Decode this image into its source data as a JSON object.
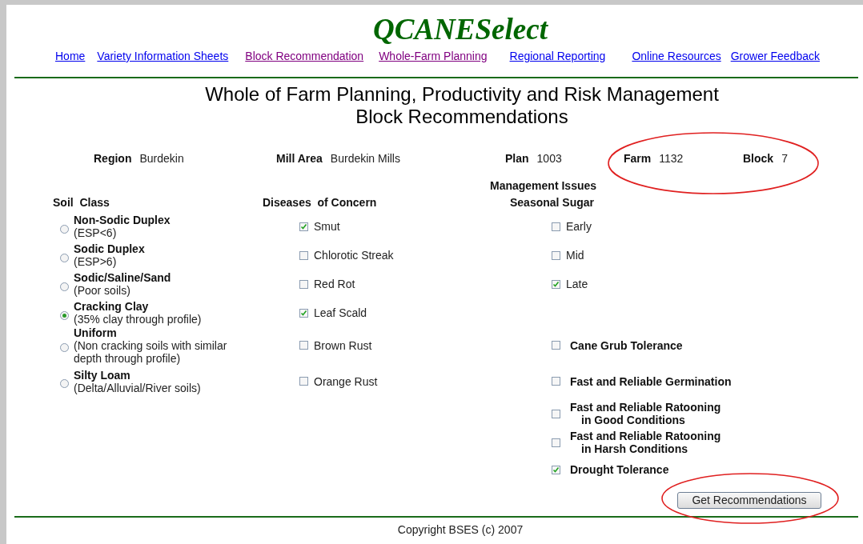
{
  "site_title": "QCANESelect",
  "nav": [
    {
      "label": "Home",
      "visited": false
    },
    {
      "label": "Variety Information Sheets",
      "visited": false
    },
    {
      "label": "Block Recommendation",
      "visited": true
    },
    {
      "label": "Whole-Farm Planning",
      "visited": true
    },
    {
      "label": "Regional Reporting",
      "visited": false
    },
    {
      "label": "Online Resources",
      "visited": false
    },
    {
      "label": "Grower Feedback",
      "visited": false
    }
  ],
  "heading": [
    "Whole of Farm Planning, Productivity and Risk Management",
    "Block Recommendations"
  ],
  "info": [
    {
      "label": "Region",
      "value": "Burdekin"
    },
    {
      "label": "Mill Area",
      "value": "Burdekin Mills"
    },
    {
      "label": "Plan",
      "value": "1003"
    },
    {
      "label": "Farm",
      "value": "1132"
    },
    {
      "label": "Block",
      "value": "7"
    }
  ],
  "soil_class": {
    "title": "Soil  Class",
    "options": [
      {
        "name": "Non-Sodic Duplex",
        "description": "(ESP<6)",
        "selected": false
      },
      {
        "name": "Sodic Duplex",
        "description": "(ESP>6)",
        "selected": false
      },
      {
        "name": "Sodic/Saline/Sand",
        "description": "(Poor soils)",
        "selected": false
      },
      {
        "name": "Cracking Clay",
        "description": "(35% clay through profile)",
        "selected": true
      },
      {
        "name": "Uniform",
        "description": "(Non cracking soils with similar depth through profile)",
        "selected": false
      },
      {
        "name": "Silty Loam",
        "description": "(Delta/Alluvial/River soils)",
        "selected": false
      }
    ]
  },
  "diseases": {
    "title": "Diseases  of Concern",
    "items": [
      {
        "label": "Smut",
        "checked": true
      },
      {
        "label": "Chlorotic Streak",
        "checked": false
      },
      {
        "label": "Red Rot",
        "checked": false
      },
      {
        "label": "Leaf Scald",
        "checked": true
      },
      {
        "label": "Brown Rust",
        "checked": false
      },
      {
        "label": "Orange Rust",
        "checked": false
      }
    ]
  },
  "management": {
    "title": "Management Issues",
    "seasonal_sugar": {
      "title": "Seasonal Sugar",
      "items": [
        {
          "label": "Early",
          "checked": false
        },
        {
          "label": "Mid",
          "checked": false
        },
        {
          "label": "Late",
          "checked": true
        }
      ]
    },
    "traits": [
      {
        "lines": [
          "Cane Grub Tolerance"
        ],
        "checked": false
      },
      {
        "lines": [
          "Fast and Reliable Germination"
        ],
        "checked": false
      },
      {
        "lines": [
          "Fast and Reliable Ratooning",
          "in Good Conditions"
        ],
        "checked": false
      },
      {
        "lines": [
          "Fast and Reliable Ratooning",
          "in Harsh Conditions"
        ],
        "checked": false
      },
      {
        "lines": [
          "Drought Tolerance"
        ],
        "checked": true
      }
    ]
  },
  "button": "Get Recommendations",
  "footer": "Copyright BSES (c) 2007"
}
